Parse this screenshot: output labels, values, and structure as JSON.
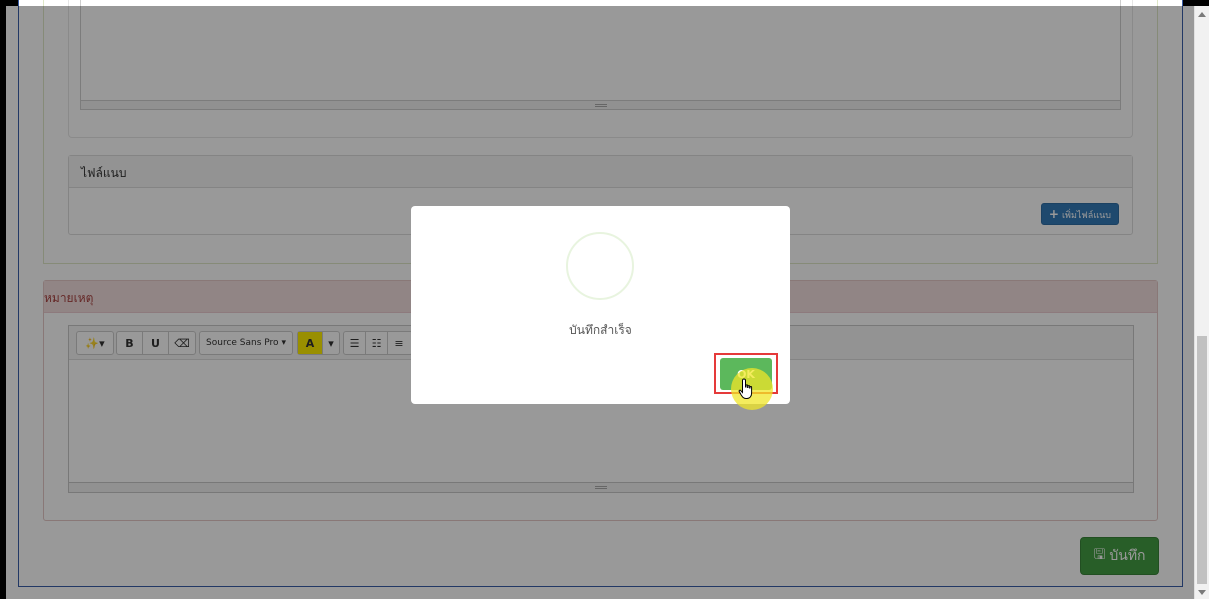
{
  "attachments": {
    "header": "ไฟล์แนบ",
    "add_button": "เพิ่มไฟล์แนบ"
  },
  "remarks": {
    "header": "หมายเหตุ",
    "toolbar": {
      "font_name": "Source Sans Pro",
      "bold": "B",
      "underline": "U",
      "color": "A"
    }
  },
  "save_button": "บันทึก",
  "dialog": {
    "title": "บันทึกสำเร็จ",
    "ok_label": "OK"
  },
  "colors": {
    "primary": "#337ab7",
    "success": "#5cb85c",
    "danger_panel": "#f2dede"
  }
}
